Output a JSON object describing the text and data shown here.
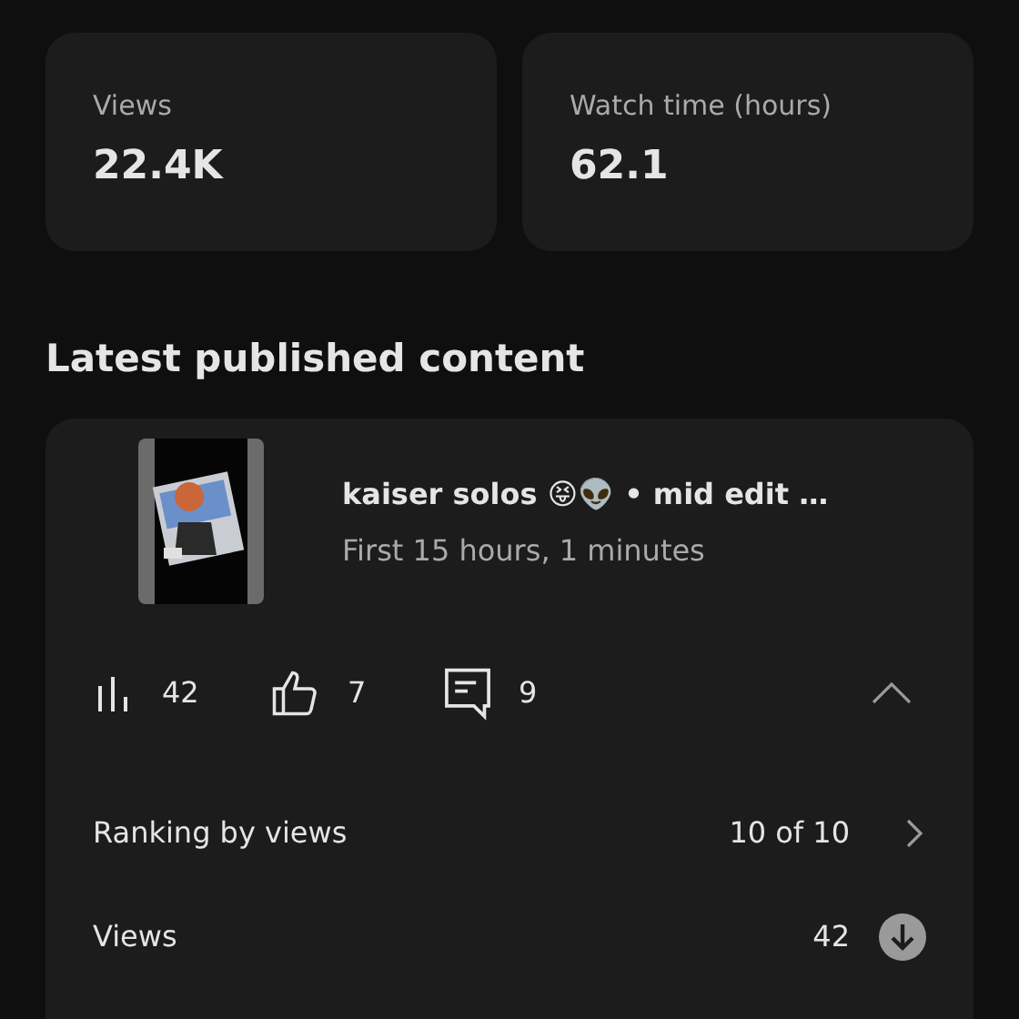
{
  "metric_cards": [
    {
      "label": "Views",
      "value": "22.4K"
    },
    {
      "label": "Watch time (hours)",
      "value": "62.1"
    }
  ],
  "section_title": "Latest published content",
  "content": {
    "title": "kaiser solos 😝👽 • mid edit …",
    "subtitle": "First 15 hours, 1 minutes",
    "stats": [
      {
        "kind": "views",
        "value": "42"
      },
      {
        "kind": "likes",
        "value": "7"
      },
      {
        "kind": "comments",
        "value": "9"
      }
    ],
    "expanded": true,
    "rows": [
      {
        "label": "Ranking by views",
        "value": "10 of 10",
        "kind": "link"
      },
      {
        "label": "Views",
        "value": "42",
        "kind": "trend_down"
      }
    ]
  }
}
